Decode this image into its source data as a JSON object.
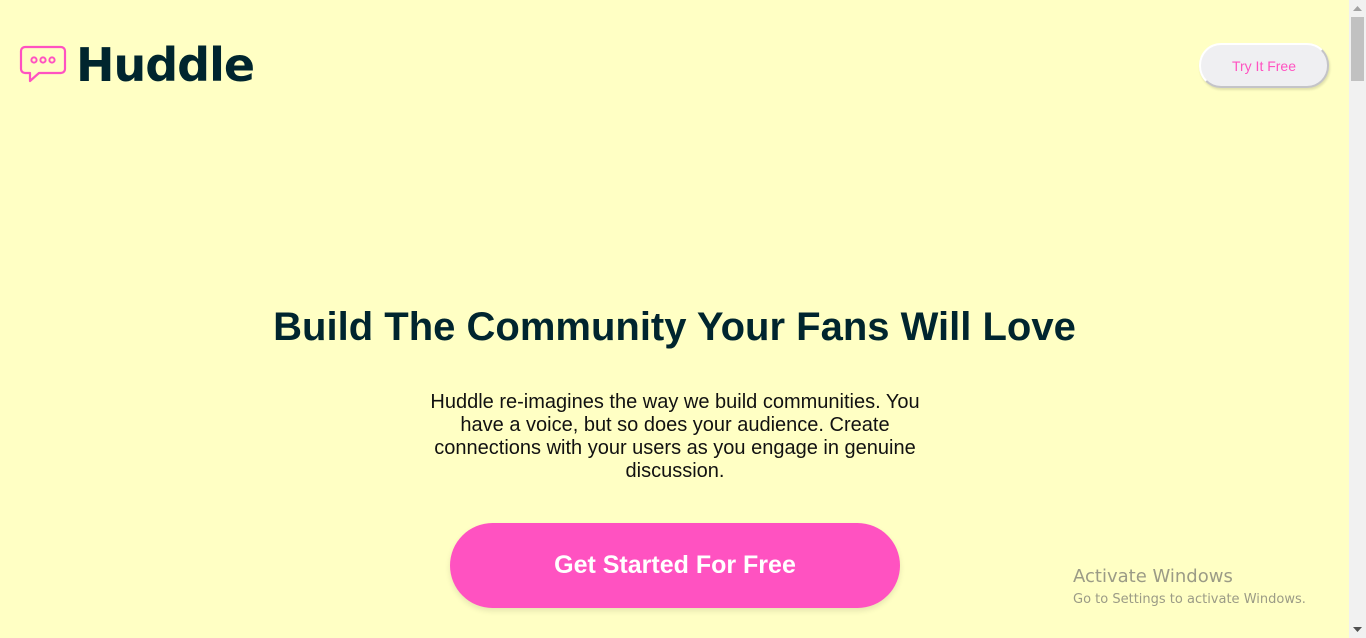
{
  "header": {
    "logo_text": "Huddle",
    "logo_icon": "chat-bubble-icon",
    "try_button_label": "Try It Free"
  },
  "hero": {
    "headline": "Build The Community Your Fans Will Love",
    "description": "Huddle re-imagines the way we build communities. You have a voice, but so does your audience. Create connections with your users as you engage in genuine discussion.",
    "cta_label": "Get Started For Free"
  },
  "watermark": {
    "title": "Activate Windows",
    "subtitle": "Go to Settings to activate Windows."
  },
  "colors": {
    "background": "#ffffc4",
    "accent": "#ff52c1",
    "text_dark": "#00252e"
  }
}
